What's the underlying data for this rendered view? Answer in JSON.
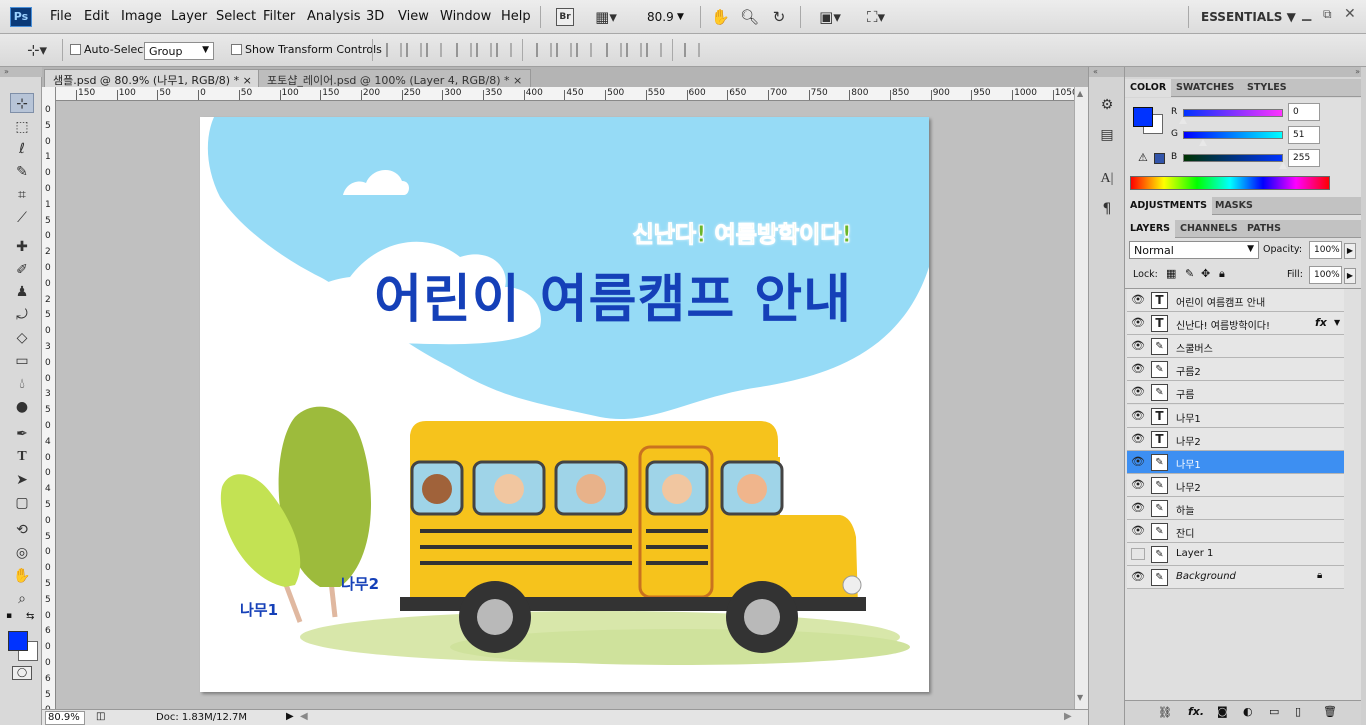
{
  "app": {
    "logo": "Ps"
  },
  "menu": [
    "File",
    "Edit",
    "Image",
    "Layer",
    "Select",
    "Filter",
    "Analysis",
    "3D",
    "View",
    "Window",
    "Help"
  ],
  "toolbar": {
    "bridge": "Br",
    "zoom": "80.9",
    "workspace": "ESSENTIALS"
  },
  "options": {
    "auto_select_label": "Auto-Select:",
    "auto_select_value": "Group",
    "transform_label": "Show Transform Controls"
  },
  "tabs": [
    {
      "label": "샘플.psd @ 80.9% (나무1, RGB/8) *",
      "close": "×"
    },
    {
      "label": "포토샵_레이어.psd @ 100% (Layer 4, RGB/8) *",
      "close": "×"
    }
  ],
  "ruler": {
    "h": [
      "150",
      "100",
      "50",
      "0",
      "50",
      "100",
      "150",
      "200",
      "250",
      "300",
      "350",
      "400",
      "450",
      "500",
      "550",
      "600",
      "650",
      "700",
      "750",
      "800",
      "850",
      "900",
      "950",
      "1000",
      "1050"
    ],
    "v": [
      "0",
      "5",
      "0",
      "1",
      "0",
      "0",
      "1",
      "5",
      "0",
      "2",
      "0",
      "0",
      "2",
      "5",
      "0",
      "3",
      "0",
      "0",
      "3",
      "5",
      "0",
      "4",
      "0",
      "0",
      "4",
      "5",
      "0",
      "5",
      "0",
      "0",
      "5",
      "5",
      "0",
      "6",
      "0",
      "0",
      "6",
      "5",
      "0"
    ]
  },
  "canvas": {
    "subtitle": "신난다! 여름방학이다!",
    "title": "어린이 여름캠프 안내",
    "tree1_label": "나무1",
    "tree2_label": "나무2"
  },
  "status": {
    "zoom": "80.9%",
    "doc": "Doc: 1.83M/12.7M"
  },
  "color_panel": {
    "tabs": [
      "COLOR",
      "SWATCHES",
      "STYLES"
    ],
    "r_label": "R",
    "g_label": "G",
    "b_label": "B",
    "r": "0",
    "g": "51",
    "b": "255",
    "r_value": 0,
    "g_value": 51,
    "b_value": 255,
    "foreground": "#0033ff"
  },
  "adjust_panel": {
    "tabs": [
      "ADJUSTMENTS",
      "MASKS"
    ]
  },
  "layers_panel": {
    "tabs": [
      "LAYERS",
      "CHANNELS",
      "PATHS"
    ],
    "blend_mode": "Normal",
    "opacity_label": "Opacity:",
    "opacity": "100%",
    "lock_label": "Lock:",
    "fill_label": "Fill:",
    "fill": "100%",
    "layers": [
      {
        "name": "어린이 여름캠프 안내",
        "type": "text",
        "visible": true
      },
      {
        "name": "신난다! 여름방학이다!",
        "type": "text",
        "visible": true,
        "fx": "fx"
      },
      {
        "name": "스쿨버스",
        "type": "image",
        "visible": true
      },
      {
        "name": "구름2",
        "type": "image",
        "visible": true
      },
      {
        "name": "구름",
        "type": "image",
        "visible": true
      },
      {
        "name": "나무1",
        "type": "text",
        "visible": true
      },
      {
        "name": "나무2",
        "type": "text",
        "visible": true
      },
      {
        "name": "나무1",
        "type": "image",
        "visible": true,
        "selected": true
      },
      {
        "name": "나무2",
        "type": "image",
        "visible": true
      },
      {
        "name": "하늘",
        "type": "image",
        "visible": true
      },
      {
        "name": "잔디",
        "type": "image",
        "visible": true
      },
      {
        "name": "Layer 1",
        "type": "image",
        "visible": false
      },
      {
        "name": "Background",
        "type": "image",
        "visible": true,
        "locked": true
      }
    ]
  }
}
